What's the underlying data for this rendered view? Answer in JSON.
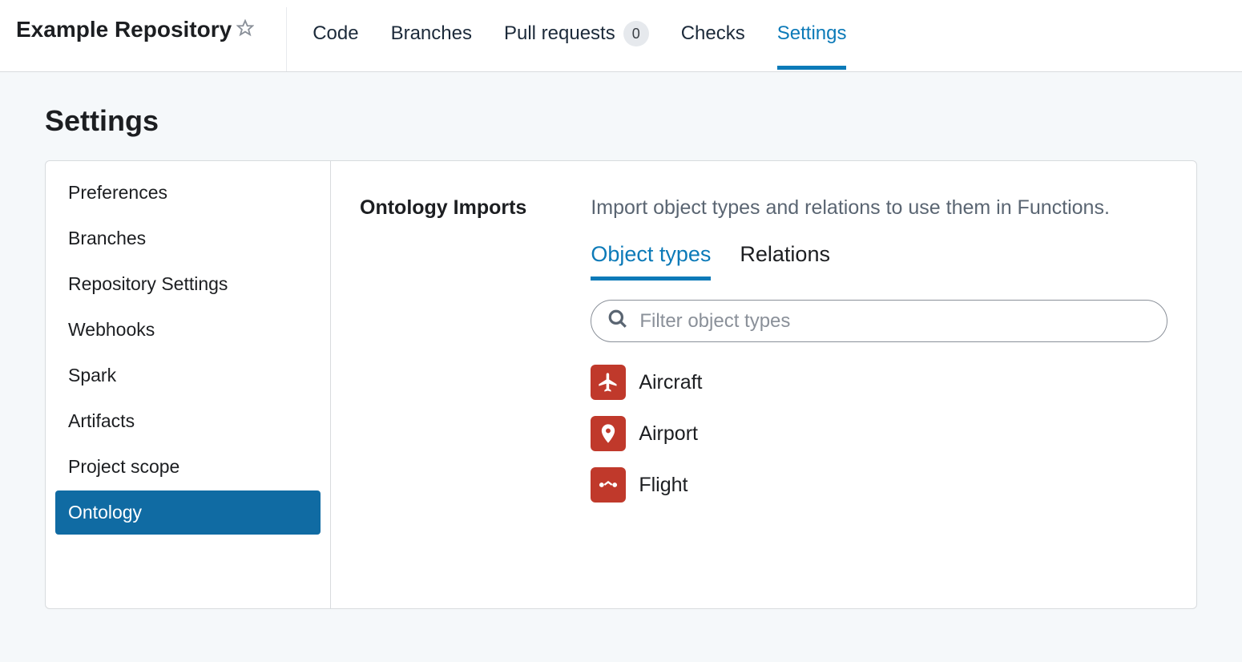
{
  "header": {
    "repo_title": "Example Repository",
    "tabs": [
      {
        "label": "Code"
      },
      {
        "label": "Branches"
      },
      {
        "label": "Pull requests",
        "badge": "0"
      },
      {
        "label": "Checks"
      },
      {
        "label": "Settings",
        "active": true
      }
    ]
  },
  "page": {
    "title": "Settings"
  },
  "sidebar": {
    "items": [
      {
        "label": "Preferences"
      },
      {
        "label": "Branches"
      },
      {
        "label": "Repository Settings"
      },
      {
        "label": "Webhooks"
      },
      {
        "label": "Spark"
      },
      {
        "label": "Artifacts"
      },
      {
        "label": "Project scope"
      },
      {
        "label": "Ontology",
        "active": true
      }
    ]
  },
  "ontology": {
    "title": "Ontology Imports",
    "description": "Import object types and relations to use them in Functions.",
    "tabs": [
      {
        "label": "Object types",
        "active": true
      },
      {
        "label": "Relations"
      }
    ],
    "search": {
      "placeholder": "Filter object types"
    },
    "objects": [
      {
        "label": "Aircraft",
        "icon": "airplane"
      },
      {
        "label": "Airport",
        "icon": "pin"
      },
      {
        "label": "Flight",
        "icon": "flight"
      }
    ]
  }
}
